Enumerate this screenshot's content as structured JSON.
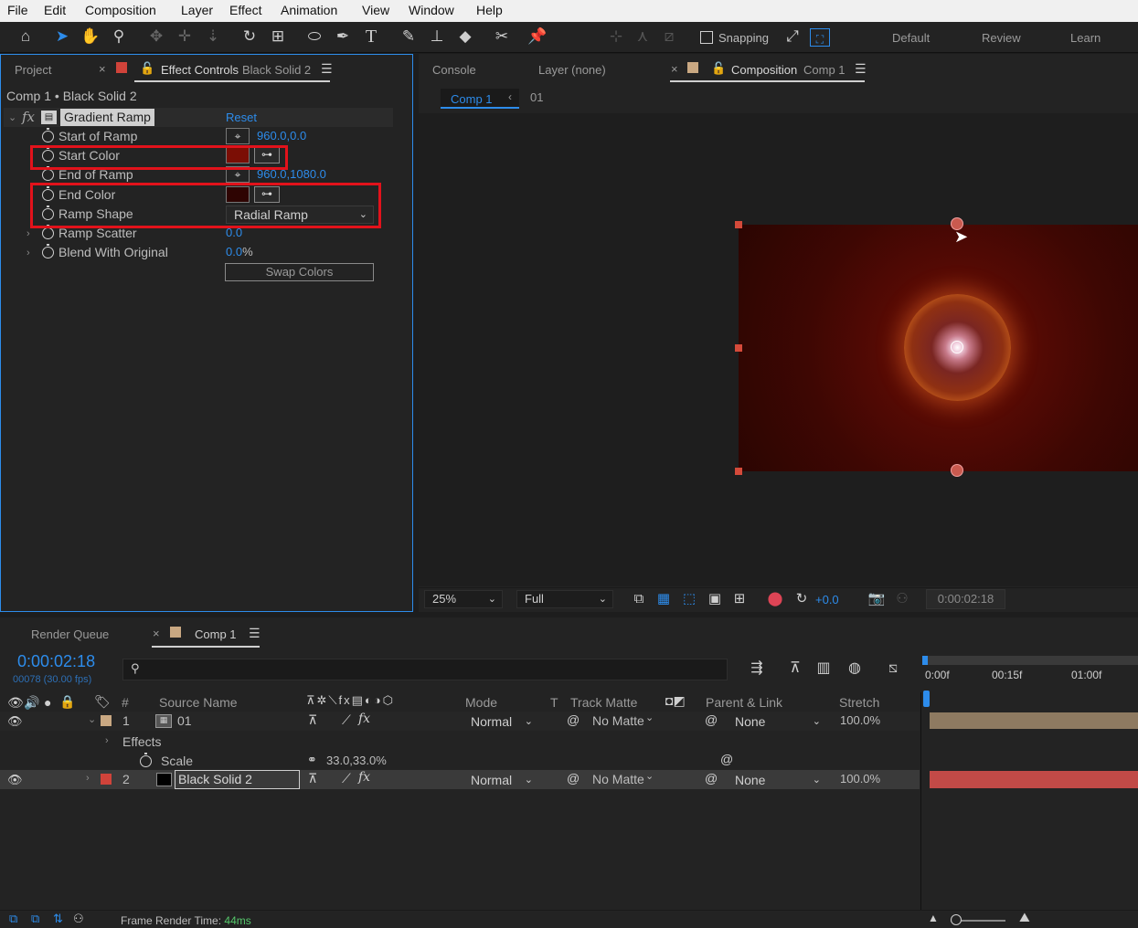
{
  "menu": [
    "File",
    "Edit",
    "Composition",
    "Layer",
    "Effect",
    "Animation",
    "View",
    "Window",
    "Help"
  ],
  "toolbar": {
    "snapping_label": "Snapping",
    "workspaces": [
      "Default",
      "Review",
      "Learn"
    ]
  },
  "left_panel": {
    "project_tab": "Project",
    "ec_tab_label": "Effect Controls",
    "ec_tab_layer": "Black Solid 2",
    "breadcrumb": "Comp 1 • Black Solid 2",
    "effect_name": "Gradient Ramp",
    "reset_label": "Reset",
    "properties": [
      {
        "label": "Start of Ramp",
        "value": "960.0,0.0"
      },
      {
        "label": "Start Color",
        "value": ""
      },
      {
        "label": "End of Ramp",
        "value": "960.0,1080.0"
      },
      {
        "label": "End Color",
        "value": ""
      },
      {
        "label": "Ramp Shape",
        "value": "Radial Ramp"
      },
      {
        "label": "Ramp Scatter",
        "value": "0.0"
      },
      {
        "label": "Blend With Original",
        "value_num": "0.0",
        "value_unit": "%"
      }
    ],
    "swap_colors_label": "Swap Colors",
    "start_color": "#7b0e05",
    "end_color": "#2e0402"
  },
  "viewer": {
    "console_tab": "Console",
    "layer_tab": "Layer (none)",
    "comp_tab_label": "Composition",
    "comp_tab_name": "Comp 1",
    "nav_current": "Comp 1",
    "nav_next": "01",
    "zoom": "25%",
    "resolution": "Full",
    "exposure": "+0.0",
    "timecode": "0:00:02:18"
  },
  "timeline": {
    "render_queue_tab": "Render Queue",
    "comp_tab": "Comp 1",
    "current_time": "0:00:02:18",
    "frame_info": "00078 (30.00 fps)",
    "search_placeholder": "",
    "columns": {
      "num": "#",
      "source_name": "Source Name",
      "mode": "Mode",
      "t": "T",
      "track_matte": "Track Matte",
      "parent_link": "Parent & Link",
      "stretch": "Stretch"
    },
    "layers": [
      {
        "num": "1",
        "name": "01",
        "mode": "Normal",
        "matte": "No Matte",
        "parent": "None",
        "stretch": "100.0%",
        "label_color": "#c9a882"
      },
      {
        "num": "2",
        "name": "Black Solid 2",
        "mode": "Normal",
        "matte": "No Matte",
        "parent": "None",
        "stretch": "100.0%",
        "label_color": "#d0433a"
      }
    ],
    "effects_label": "Effects",
    "scale_label": "Scale",
    "scale_value": "33.0,33.0%",
    "ruler": [
      "0:00f",
      "00:15f",
      "01:00f"
    ],
    "frame_render_label": "Frame Render Time:",
    "frame_render_value": "44ms"
  },
  "colors": {
    "accent": "#2d8ceb",
    "highlight_box": "#e2121b"
  }
}
